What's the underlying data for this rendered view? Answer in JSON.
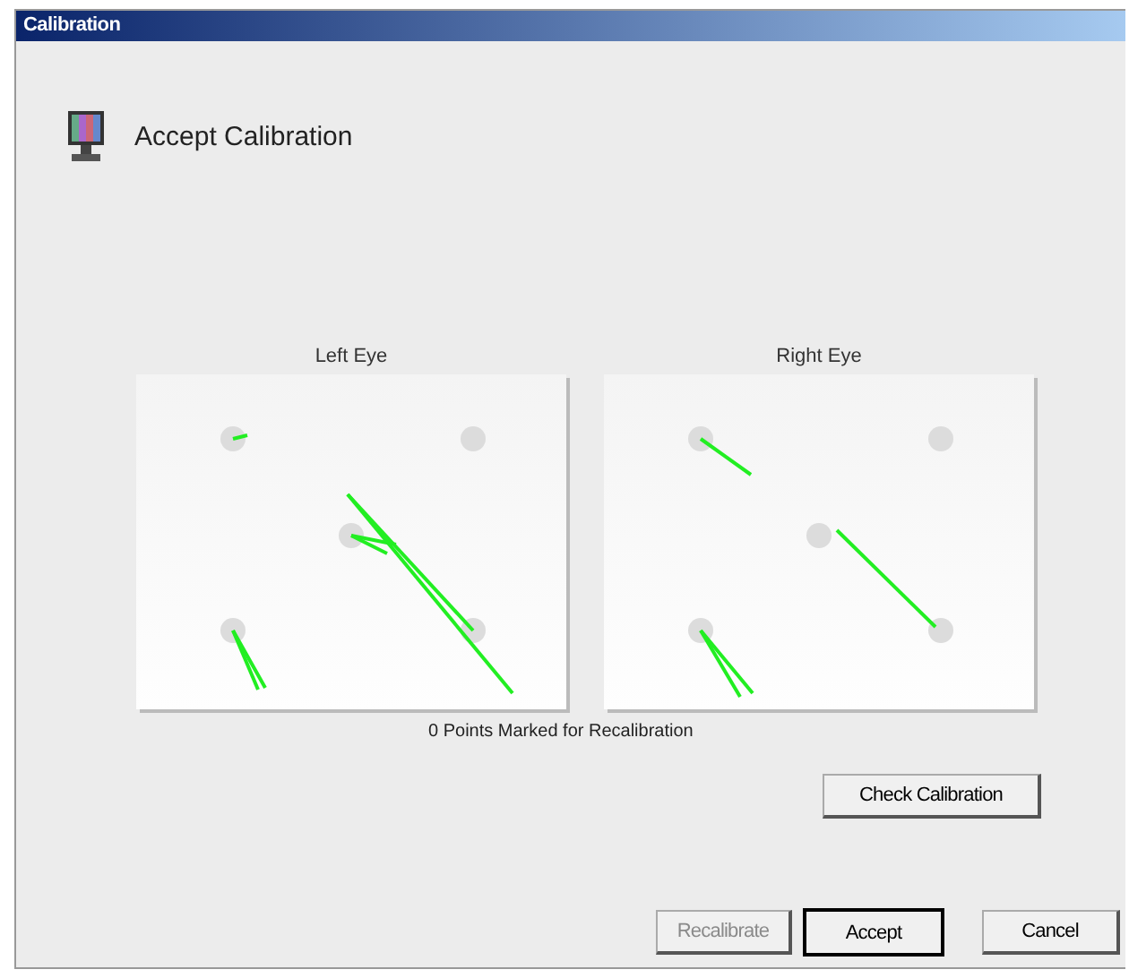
{
  "window": {
    "title": "Calibration"
  },
  "header": {
    "title": "Accept Calibration"
  },
  "eyes": [
    {
      "label": "Left Eye"
    },
    {
      "label": "Right Eye"
    }
  ],
  "status": "0 Points Marked for Recalibration",
  "check_button": {
    "label": "Check Calibration"
  },
  "buttons": [
    {
      "label": "Recalibrate",
      "disabled": true,
      "default": false
    },
    {
      "label": "Accept",
      "disabled": false,
      "default": true
    },
    {
      "label": "Cancel",
      "disabled": false,
      "default": false
    }
  ]
}
